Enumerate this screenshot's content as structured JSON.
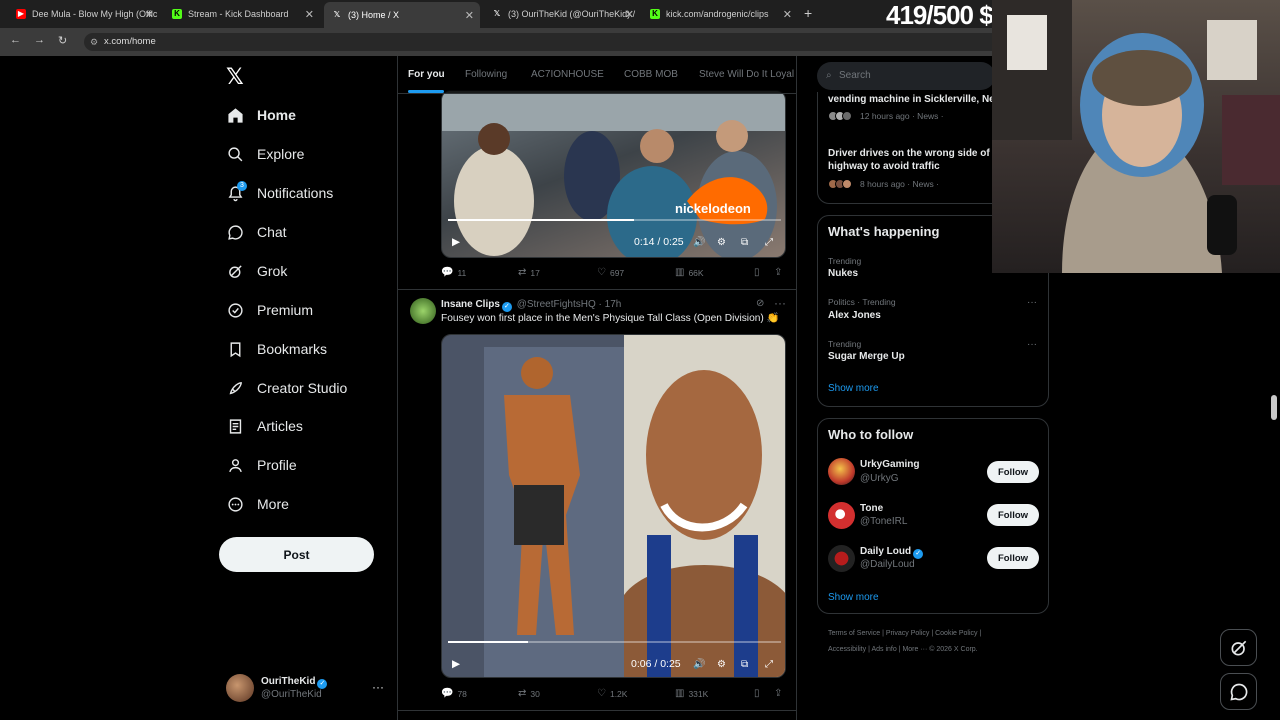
{
  "browser": {
    "tabs": [
      {
        "title": "Dee Mula - Blow My High (Offic",
        "favicon": "youtube-icon",
        "color": "#ff0000"
      },
      {
        "title": "Stream - Kick Dashboard",
        "favicon": "kick-icon",
        "color": "#53fc18"
      },
      {
        "title": "(3) Home / X",
        "favicon": "x-icon",
        "color": "#ffffff"
      },
      {
        "title": "(3) OuriTheKid (@OuriTheKid) /",
        "favicon": "x-icon",
        "color": "#ffffff"
      },
      {
        "title": "kick.com/androgenic/clips",
        "favicon": "kick-icon",
        "color": "#53fc18"
      }
    ],
    "url": "x.com/home"
  },
  "stream_overlay": {
    "counter": "419/500 $"
  },
  "sidebar": {
    "items": [
      {
        "label": "Home",
        "icon": "home-icon"
      },
      {
        "label": "Explore",
        "icon": "search-icon"
      },
      {
        "label": "Notifications",
        "icon": "bell-icon",
        "badge": "3"
      },
      {
        "label": "Chat",
        "icon": "chat-icon"
      },
      {
        "label": "Grok",
        "icon": "grok-icon"
      },
      {
        "label": "Premium",
        "icon": "premium-icon"
      },
      {
        "label": "Bookmarks",
        "icon": "bookmark-icon"
      },
      {
        "label": "Creator Studio",
        "icon": "rocket-icon"
      },
      {
        "label": "Articles",
        "icon": "articles-icon"
      },
      {
        "label": "Profile",
        "icon": "person-icon"
      },
      {
        "label": "More",
        "icon": "more-circle-icon"
      }
    ],
    "post_label": "Post",
    "account": {
      "name": "OuriTheKid",
      "handle": "@OuriTheKid"
    }
  },
  "feed": {
    "tabs": [
      "For you",
      "Following",
      "AC7IONHOUSE",
      "COBB MOB",
      "Steve Will Do It Loyal"
    ],
    "posts": [
      {
        "video_overlay_text": "nickelodeon",
        "video_time": "0:14 / 0:25",
        "progress": 0.56,
        "replies": "11",
        "reposts": "17",
        "likes": "697",
        "views": "66K"
      },
      {
        "author": "Insane Clips",
        "handle": "@StreetFightsHQ",
        "age": "17h",
        "text": "Fousey won first place in the Men's Physique Tall Class (Open Division) 👏",
        "video_time": "0:06 / 0:25",
        "progress": 0.24,
        "replies": "78",
        "reposts": "30",
        "likes": "1.2K",
        "views": "331K"
      }
    ]
  },
  "right": {
    "search_placeholder": "Search",
    "news": [
      {
        "title": "vending machine in Sicklerville, Ne",
        "meta": "12 hours ago · News ·"
      },
      {
        "title": "Driver drives on the wrong side of t highway to avoid traffic",
        "meta": "8 hours ago · News ·"
      }
    ],
    "whats_happening": {
      "title": "What's happening",
      "trends": [
        {
          "category": "Trending",
          "name": "Nukes"
        },
        {
          "category": "Politics · Trending",
          "name": "Alex Jones"
        },
        {
          "category": "Trending",
          "name": "Sugar Merge Up"
        }
      ],
      "show_more": "Show more"
    },
    "who_to_follow": {
      "title": "Who to follow",
      "accounts": [
        {
          "name": "UrkyGaming",
          "handle": "@UrkyG",
          "verified": false,
          "color": "#c0392b"
        },
        {
          "name": "Tone",
          "handle": "@ToneIRL",
          "verified": false,
          "color": "#d32f2f"
        },
        {
          "name": "Daily Loud",
          "handle": "@DailyLoud",
          "verified": true,
          "color": "#b71c1c"
        }
      ],
      "follow_label": "Follow",
      "show_more": "Show more"
    },
    "footer": {
      "row1": "Terms of Service  |  Privacy Policy  |  Cookie Policy  |",
      "row2": "Accessibility  |  Ads info  |  More ···  © 2026 X Corp."
    }
  }
}
